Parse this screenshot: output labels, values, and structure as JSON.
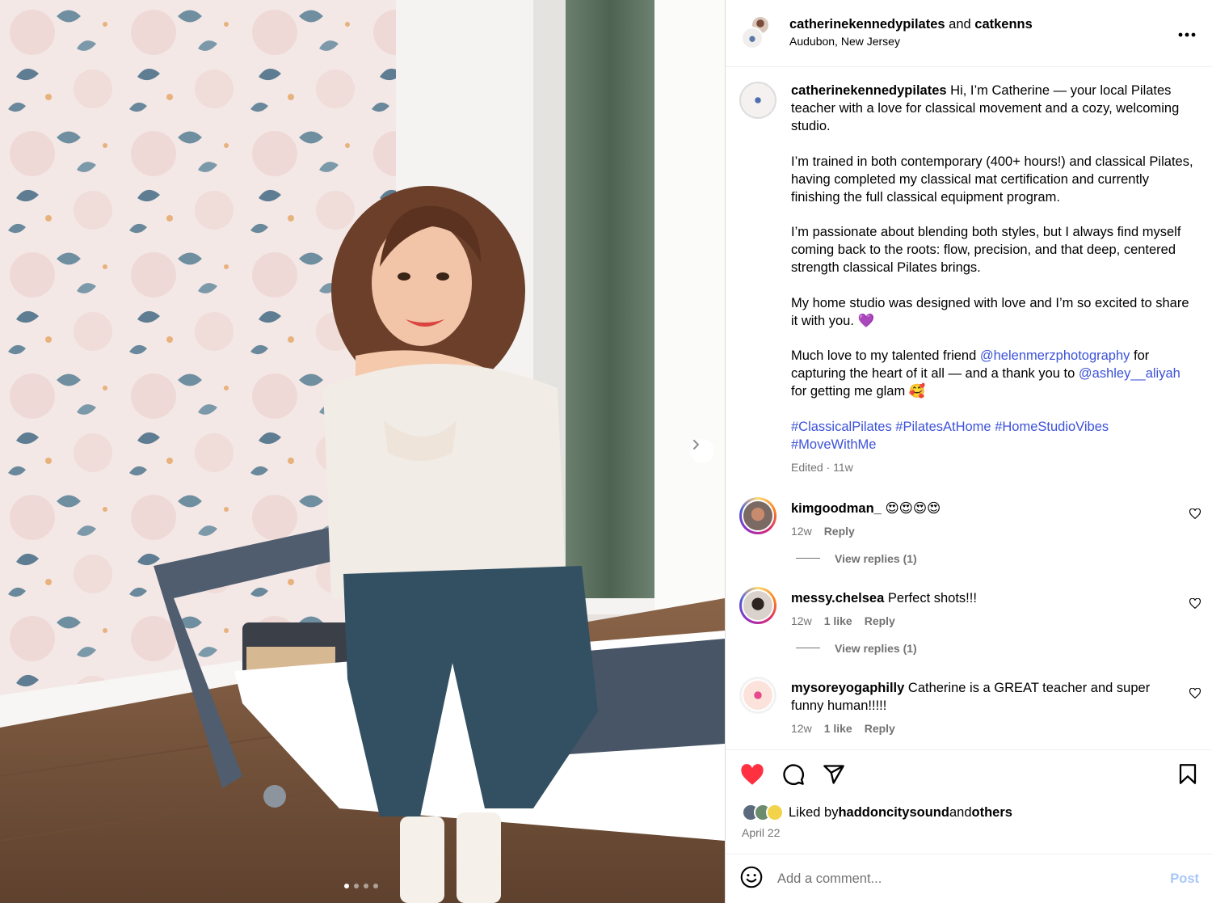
{
  "post_header": {
    "author": "catherinekennedypilates",
    "connector": " and ",
    "collaborator": "catkenns",
    "location": "Audubon, New Jersey",
    "more_icon": "more-horizontal-icon"
  },
  "caption": {
    "username": "catherinekennedypilates",
    "paragraph1": " Hi, I’m Catherine — your local Pilates teacher with a love for classical movement and a cozy, welcoming studio.",
    "paragraph2": "I’m trained in both contemporary (400+ hours!) and classical Pilates, having completed my classical mat certification and currently finishing the full classical equipment program.",
    "paragraph3": "I’m passionate about blending both styles, but I always find myself coming back to the roots: flow, precision, and that deep, centered strength classical Pilates brings.",
    "paragraph4": "My home studio was designed with love and I’m so excited to share it with you. 💜",
    "p5_a": "Much love to my talented friend ",
    "p5_mention1": "@helenmerzphotography",
    "p5_b": " for capturing the heart of it all — and a thank you to ",
    "p5_mention2": "@ashley__aliyah",
    "p5_c": " for getting me glam 🥰",
    "hashtags": "#ClassicalPilates #PilatesAtHome #HomeStudioVibes #MoveWithMe",
    "meta": "Edited · 11w"
  },
  "comments": [
    {
      "username": "kimgoodman_",
      "text": " 😍😍😍😍",
      "time": "12w",
      "likes": "",
      "reply": "Reply",
      "view_replies": "View replies (1)"
    },
    {
      "username": "messy.chelsea",
      "text": " Perfect shots!!!",
      "time": "12w",
      "likes": "1 like",
      "reply": "Reply",
      "view_replies": "View replies (1)"
    },
    {
      "username": "mysoreyogaphilly",
      "text": " Catherine is a GREAT teacher and super funny human!!!!!",
      "time": "12w",
      "likes": "1 like",
      "reply": "Reply"
    }
  ],
  "actions": {
    "like_icon": "heart-filled-icon",
    "comment_icon": "comment-icon",
    "share_icon": "share-icon",
    "save_icon": "bookmark-icon",
    "like_color": "#ff3040"
  },
  "likes": {
    "prefix": "Liked by ",
    "user": "haddoncitysound",
    "middle": " and ",
    "others": "others"
  },
  "date": "April 22",
  "add_comment": {
    "placeholder": "Add a comment...",
    "post_label": "Post",
    "emoji_icon": "emoji-icon"
  },
  "carousel": {
    "slide_count": 4,
    "current": 1
  }
}
